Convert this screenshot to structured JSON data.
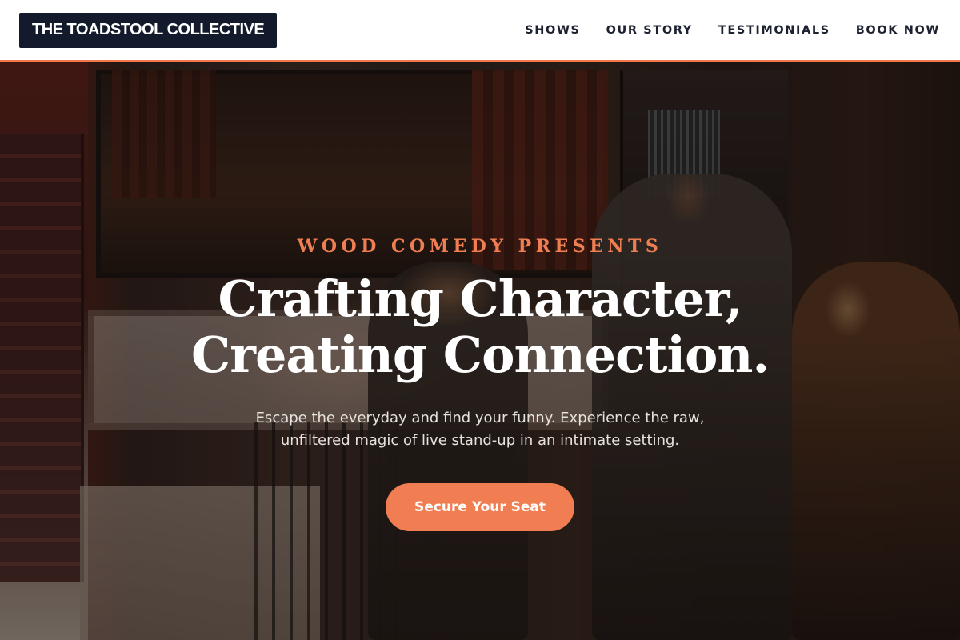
{
  "header": {
    "logo": "THE TOADSTOOL COLLECTIVE",
    "nav": [
      {
        "label": "SHOWS"
      },
      {
        "label": "OUR STORY"
      },
      {
        "label": "TESTIMONIALS"
      },
      {
        "label": "BOOK NOW"
      }
    ]
  },
  "hero": {
    "eyebrow": "WOOD COMEDY PRESENTS",
    "headline_line1": "Crafting Character,",
    "headline_line2": "Creating Connection.",
    "subtitle_line1": "Escape the everyday and find your funny. Experience the raw,",
    "subtitle_line2": "unfiltered magic of live stand-up in an intimate setting.",
    "cta_label": "Secure Your Seat"
  },
  "colors": {
    "accent": "#f07e52",
    "logo_bg": "#121a2b",
    "nav_text": "#1c2230"
  }
}
